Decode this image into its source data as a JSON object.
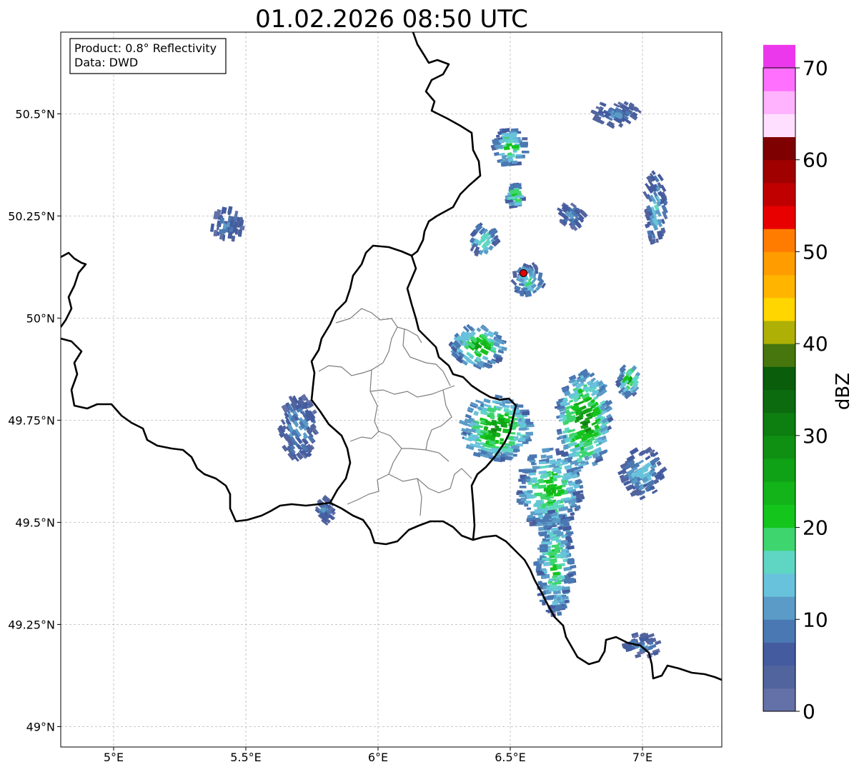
{
  "title": "01.02.2026 08:50 UTC",
  "info_box": {
    "line1": "Product: 0.8° Reflectivity",
    "line2": "Data: DWD"
  },
  "map": {
    "lon_range": [
      4.8,
      7.3
    ],
    "lat_range": [
      48.95,
      50.7
    ],
    "x_ticks": [
      {
        "value": 5.0,
        "label": "5°E"
      },
      {
        "value": 5.5,
        "label": "5.5°E"
      },
      {
        "value": 6.0,
        "label": "6°E"
      },
      {
        "value": 6.5,
        "label": "6.5°E"
      },
      {
        "value": 7.0,
        "label": "7°E"
      }
    ],
    "y_ticks": [
      {
        "value": 50.5,
        "label": "50.5°N"
      },
      {
        "value": 50.25,
        "label": "50.25°N"
      },
      {
        "value": 50.0,
        "label": "50°N"
      },
      {
        "value": 49.75,
        "label": "49.75°N"
      },
      {
        "value": 49.5,
        "label": "49.5°N"
      },
      {
        "value": 49.25,
        "label": "49.25°N"
      },
      {
        "value": 49.0,
        "label": "49°N"
      }
    ],
    "grid": true,
    "radar_site": {
      "lon": 6.55,
      "lat": 50.11,
      "color": "#e00000"
    },
    "echo_areas": [
      {
        "lon": 6.5,
        "lat": 50.42,
        "rlon": 0.06,
        "rlat": 0.05,
        "dbz": 18
      },
      {
        "lon": 6.52,
        "lat": 50.3,
        "rlon": 0.03,
        "rlat": 0.03,
        "dbz": 20
      },
      {
        "lon": 6.4,
        "lat": 50.19,
        "rlon": 0.05,
        "rlat": 0.04,
        "dbz": 16
      },
      {
        "lon": 6.73,
        "lat": 50.25,
        "rlon": 0.05,
        "rlat": 0.03,
        "dbz": 10
      },
      {
        "lon": 6.9,
        "lat": 50.5,
        "rlon": 0.09,
        "rlat": 0.03,
        "dbz": 8
      },
      {
        "lon": 7.05,
        "lat": 50.27,
        "rlon": 0.04,
        "rlat": 0.09,
        "dbz": 12
      },
      {
        "lon": 6.57,
        "lat": 50.09,
        "rlon": 0.06,
        "rlat": 0.04,
        "dbz": 15
      },
      {
        "lon": 5.43,
        "lat": 50.23,
        "rlon": 0.06,
        "rlat": 0.04,
        "dbz": 8
      },
      {
        "lon": 6.38,
        "lat": 49.93,
        "rlon": 0.1,
        "rlat": 0.05,
        "dbz": 22
      },
      {
        "lon": 6.45,
        "lat": 49.73,
        "rlon": 0.13,
        "rlat": 0.08,
        "dbz": 24
      },
      {
        "lon": 6.78,
        "lat": 49.75,
        "rlon": 0.1,
        "rlat": 0.12,
        "dbz": 25
      },
      {
        "lon": 6.65,
        "lat": 49.58,
        "rlon": 0.12,
        "rlat": 0.1,
        "dbz": 20
      },
      {
        "lon": 6.67,
        "lat": 49.4,
        "rlon": 0.07,
        "rlat": 0.13,
        "dbz": 18
      },
      {
        "lon": 6.95,
        "lat": 49.85,
        "rlon": 0.04,
        "rlat": 0.04,
        "dbz": 20
      },
      {
        "lon": 7.0,
        "lat": 49.62,
        "rlon": 0.08,
        "rlat": 0.06,
        "dbz": 12
      },
      {
        "lon": 5.7,
        "lat": 49.73,
        "rlon": 0.07,
        "rlat": 0.08,
        "dbz": 10
      },
      {
        "lon": 5.8,
        "lat": 49.53,
        "rlon": 0.03,
        "rlat": 0.03,
        "dbz": 8
      },
      {
        "lon": 7.0,
        "lat": 49.2,
        "rlon": 0.07,
        "rlat": 0.03,
        "dbz": 8
      }
    ]
  },
  "colorbar": {
    "label": "dBZ",
    "min": 0,
    "max": 70,
    "step": 2.5,
    "ticks": [
      {
        "value": 0,
        "label": "0"
      },
      {
        "value": 10,
        "label": "10"
      },
      {
        "value": 20,
        "label": "20"
      },
      {
        "value": 30,
        "label": "30"
      },
      {
        "value": 40,
        "label": "40"
      },
      {
        "value": 50,
        "label": "50"
      },
      {
        "value": 60,
        "label": "60"
      },
      {
        "value": 70,
        "label": "70"
      }
    ],
    "colors": [
      "#6371a8",
      "#52649e",
      "#445c9f",
      "#4a78b2",
      "#5b9bc7",
      "#68c2dc",
      "#5fd6c3",
      "#3ed56f",
      "#14c51c",
      "#12b41a",
      "#10a216",
      "#0f9013",
      "#0d7e10",
      "#0c6b0e",
      "#095d0b",
      "#47760e",
      "#afb006",
      "#ffd600",
      "#ffb500",
      "#ff9c00",
      "#ff7c00",
      "#e80000",
      "#c00000",
      "#a00000",
      "#7f0000",
      "#ffdfff",
      "#ffb3ff",
      "#ff70ff",
      "#ec38ec"
    ]
  }
}
